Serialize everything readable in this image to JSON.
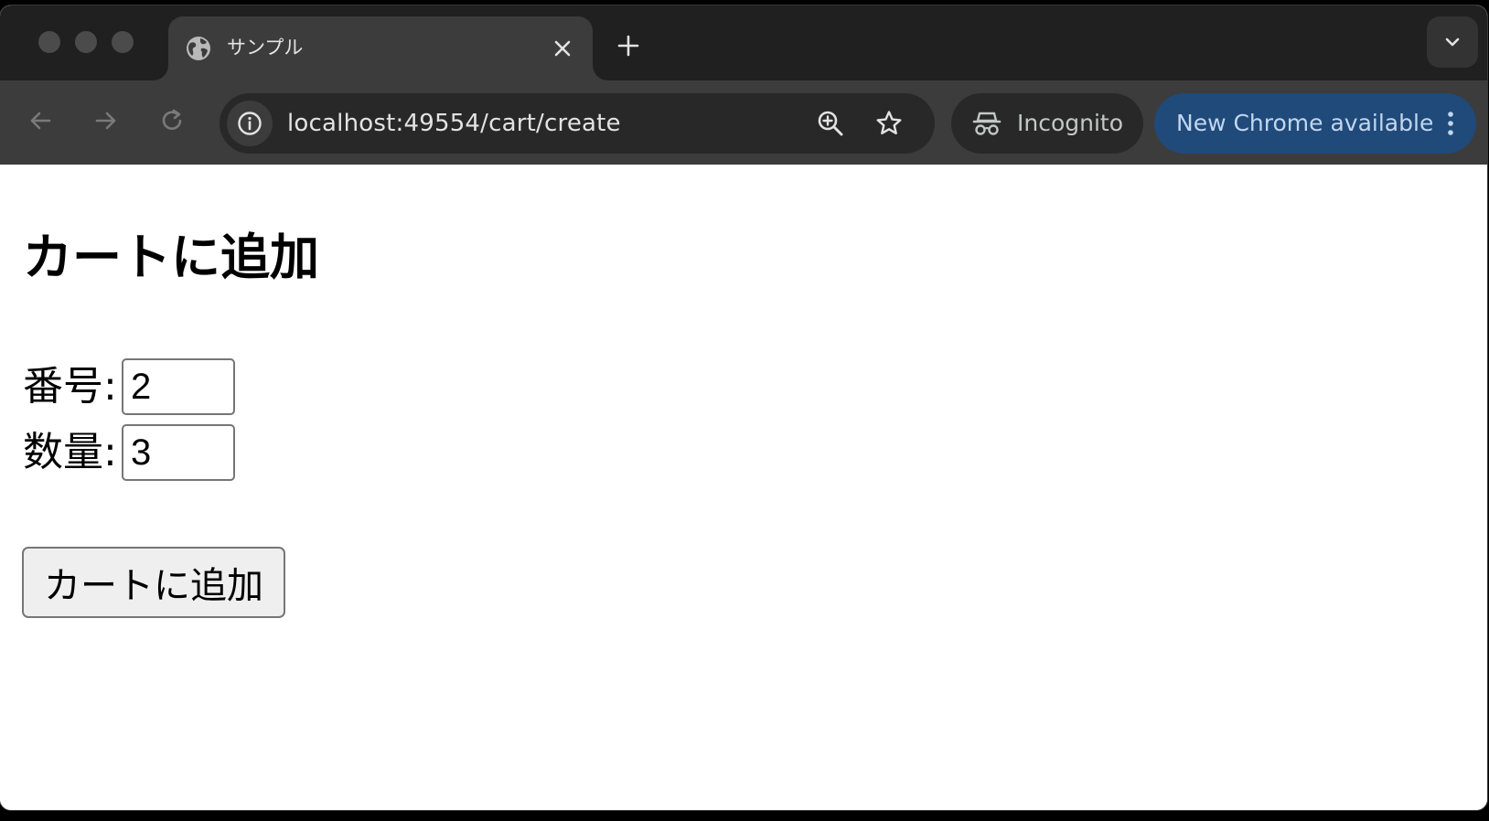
{
  "browser": {
    "tab": {
      "title": "サンプル",
      "favicon": "globe-icon"
    },
    "address_bar": {
      "url": "localhost:49554/cart/create"
    },
    "incognito_label": "Incognito",
    "update_label": "New Chrome available",
    "colors": {
      "tab_strip": "#202020",
      "toolbar": "#3c3c3c",
      "omnibox": "#282828",
      "update_chip": "#1f4a7a"
    }
  },
  "page": {
    "title": "カートに追加",
    "fields": [
      {
        "label": "番号:",
        "value": "2"
      },
      {
        "label": "数量:",
        "value": "3"
      }
    ],
    "submit_label": "カートに追加"
  }
}
